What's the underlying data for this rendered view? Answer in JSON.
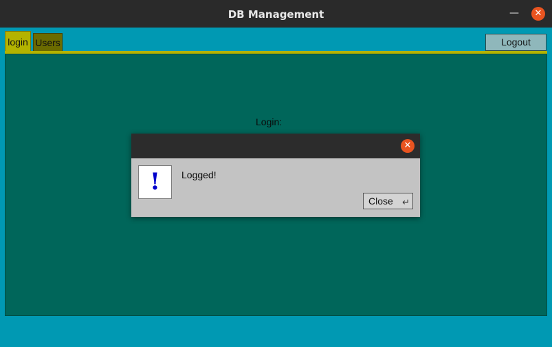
{
  "window": {
    "title": "DB Management",
    "minimize_icon": "minimize-icon",
    "close_icon": "close-icon",
    "close_color": "#e95420"
  },
  "tabs": [
    {
      "label": "login",
      "active": true,
      "color": "#b3b300"
    },
    {
      "label": "Users",
      "active": false,
      "color": "#6b6b00"
    }
  ],
  "toolbar": {
    "logout_label": "Logout"
  },
  "main": {
    "login_label": "Login:",
    "background": "#00665a"
  },
  "dialog": {
    "message": "Logged!",
    "icon": "exclamation-icon",
    "icon_glyph": "!",
    "close_label": "Close",
    "enter_icon": "enter-key-icon"
  },
  "colors": {
    "app_background": "#0099b3",
    "titlebar": "#2a2a2a"
  }
}
